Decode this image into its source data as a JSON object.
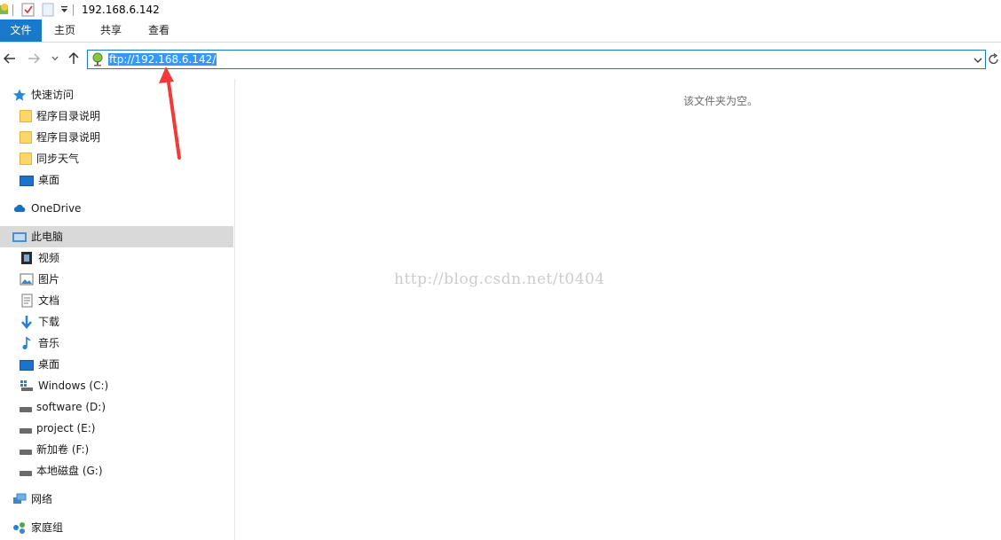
{
  "titlebar": {
    "title": "192.168.6.142"
  },
  "ribbon": {
    "tabs": [
      "文件",
      "主页",
      "共享",
      "查看"
    ]
  },
  "address": {
    "value": "ftp://192.168.6.142/"
  },
  "sidebar": {
    "quick_access": {
      "label": "快速访问",
      "items": [
        "程序目录说明",
        "程序目录说明",
        "同步天气",
        "桌面"
      ]
    },
    "onedrive": "OneDrive",
    "this_pc": {
      "label": "此电脑",
      "items": [
        "视频",
        "图片",
        "文档",
        "下载",
        "音乐",
        "桌面",
        "Windows (C:)",
        "software (D:)",
        "project (E:)",
        "新加卷 (F:)",
        "本地磁盘 (G:)"
      ]
    },
    "network": "网络",
    "homegroup": "家庭组"
  },
  "main": {
    "empty_text": "该文件夹为空。",
    "watermark": "http://blog.csdn.net/t0404"
  },
  "colors": {
    "accent": "#1979ca",
    "selection": "#3399ff",
    "annotation_arrow": "#f23a3a"
  }
}
